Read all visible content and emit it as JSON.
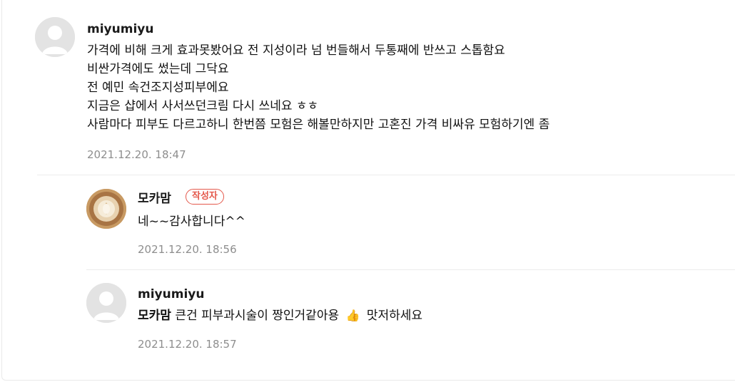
{
  "comments": [
    {
      "nickname": "miyumiyu",
      "lines": [
        "가격에 비해 크게 효과못봤어요 전 지성이라 넘 번들해서 두통째에 반쓰고 스톱함요",
        "비싼가격에도 썼는데 그닥요",
        "전 예민 속건조지성피부에요",
        "지금은 샵에서 사서쓰던크림 다시 쓰네요 ㅎㅎ",
        "사람마다 피부도 다르고하니 한번쯤 모험은 해볼만하지만 고혼진 가격 비싸유 모험하기엔 좀"
      ],
      "date": "2021.12.20. 18:47"
    }
  ],
  "replies": [
    {
      "nickname": "모카맘",
      "badge": "작성자",
      "text": "네~~감사합니다^^",
      "date": "2021.12.20. 18:56"
    },
    {
      "nickname": "miyumiyu",
      "mention": "모카맘",
      "text_before": "큰건 피부과시술이 짱인거같아용",
      "emoji": "👍",
      "text_after": "맛저하세요",
      "date": "2021.12.20. 18:57"
    }
  ],
  "colors": {
    "badge": "#e4584b",
    "date": "#8e8e8e",
    "divider": "#ececec"
  },
  "icons": {
    "default_avatar": "person-silhouette-icon",
    "author_avatar": "latte-photo"
  }
}
